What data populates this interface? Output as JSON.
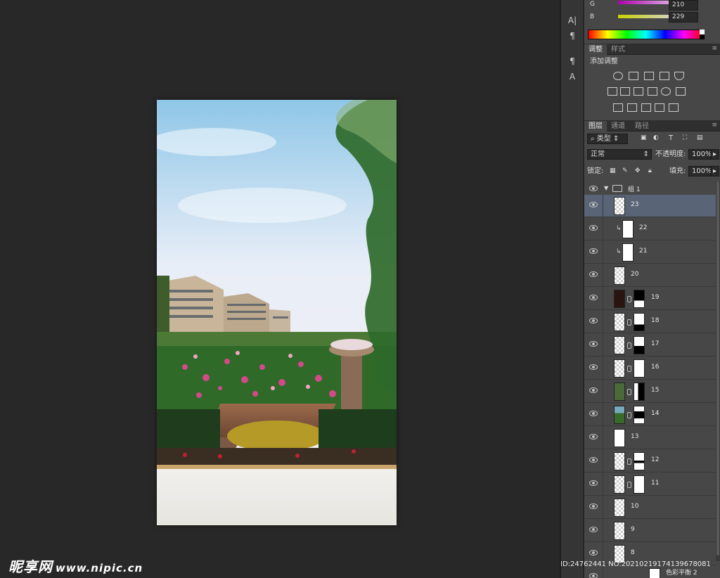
{
  "color_panel": {
    "g_label": "G",
    "g_value": "210",
    "b_label": "B",
    "b_value": "229"
  },
  "adjustments_panel": {
    "tabs": [
      "调整",
      "样式"
    ],
    "title": "添加调整"
  },
  "layers_panel": {
    "tabs": [
      "图层",
      "通道",
      "路径"
    ],
    "filter_kind": "类型",
    "blend_mode": "正常",
    "opacity_label": "不透明度:",
    "opacity_value": "100%",
    "lock_label": "锁定:",
    "fill_label": "填充:",
    "fill_value": "100%",
    "group_name": "组 1",
    "layers": [
      {
        "name": "23",
        "selected": true
      },
      {
        "name": "22",
        "clipped": true
      },
      {
        "name": "21",
        "clipped": true
      },
      {
        "name": "20"
      },
      {
        "name": "19",
        "mask": true
      },
      {
        "name": "18",
        "mask": true
      },
      {
        "name": "17",
        "mask": true
      },
      {
        "name": "16",
        "mask": true
      },
      {
        "name": "15",
        "mask": true
      },
      {
        "name": "14",
        "mask": true
      },
      {
        "name": "13"
      },
      {
        "name": "12",
        "mask": true
      },
      {
        "name": "11",
        "mask": true
      },
      {
        "name": "10"
      },
      {
        "name": "9"
      },
      {
        "name": "8"
      }
    ],
    "bottom_layer_name": "色彩平衡 2"
  },
  "watermark": {
    "logo": "昵享网",
    "url": "www.nipic.cn",
    "id_text": "ID:24762441 NO:20210219174139678081"
  },
  "icons": [
    "eye-icon",
    "chain-icon",
    "folder-icon",
    "text-tool-icon",
    "paragraph-icon"
  ]
}
